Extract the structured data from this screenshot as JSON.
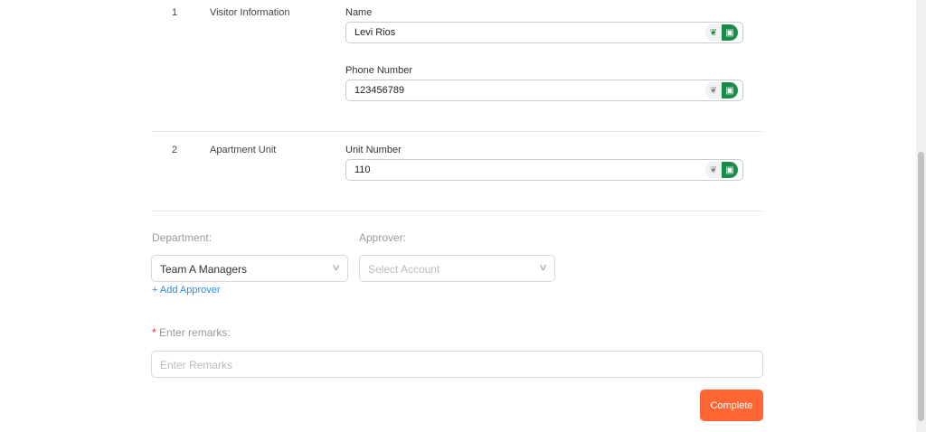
{
  "rows": [
    {
      "num": "1",
      "label": "Visitor Information",
      "fields": [
        {
          "label": "Name",
          "value": "Levi Rios"
        },
        {
          "label": "Phone Number",
          "value": "123456789"
        }
      ]
    },
    {
      "num": "2",
      "label": "Apartment Unit",
      "fields": [
        {
          "label": "Unit Number",
          "value": "110"
        }
      ]
    }
  ],
  "department": {
    "label": "Department:",
    "value": "Team A Managers"
  },
  "approver": {
    "label": "Approver:",
    "placeholder": "Select Account",
    "add": "+ Add Approver"
  },
  "remarks": {
    "required": "*",
    "label": "Enter remarks:",
    "placeholder": "Enter Remarks"
  },
  "complete": "Complete",
  "colors": {
    "accent": "#ff6633",
    "ai_green": "#1a8c4a",
    "link": "#1890ff"
  }
}
